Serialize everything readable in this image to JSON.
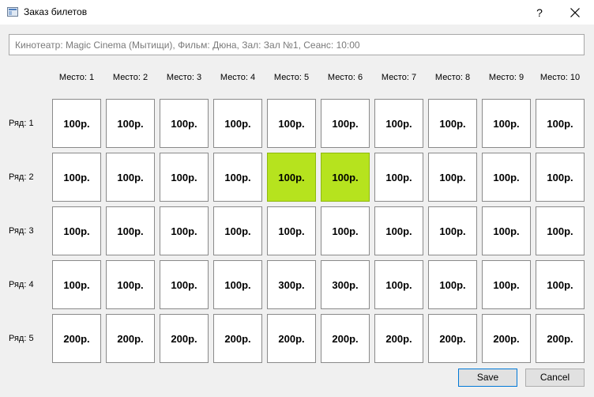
{
  "window": {
    "title": "Заказ билетов",
    "help_label": "?"
  },
  "info": {
    "text": "Кинотеатр: Magic Cinema (Мытищи), Фильм: Дюна, Зал: Зал №1, Сеанс: 10:00"
  },
  "columns": [
    "Место: 1",
    "Место: 2",
    "Место: 3",
    "Место: 4",
    "Место: 5",
    "Место: 6",
    "Место: 7",
    "Место: 8",
    "Место: 9",
    "Место: 10"
  ],
  "rows": [
    {
      "label": "Ряд: 1",
      "seats": [
        "100р.",
        "100р.",
        "100р.",
        "100р.",
        "100р.",
        "100р.",
        "100р.",
        "100р.",
        "100р.",
        "100р."
      ]
    },
    {
      "label": "Ряд: 2",
      "seats": [
        "100р.",
        "100р.",
        "100р.",
        "100р.",
        "100р.",
        "100р.",
        "100р.",
        "100р.",
        "100р.",
        "100р."
      ]
    },
    {
      "label": "Ряд: 3",
      "seats": [
        "100р.",
        "100р.",
        "100р.",
        "100р.",
        "100р.",
        "100р.",
        "100р.",
        "100р.",
        "100р.",
        "100р."
      ]
    },
    {
      "label": "Ряд: 4",
      "seats": [
        "100р.",
        "100р.",
        "100р.",
        "100р.",
        "300р.",
        "300р.",
        "100р.",
        "100р.",
        "100р.",
        "100р."
      ]
    },
    {
      "label": "Ряд: 5",
      "seats": [
        "200р.",
        "200р.",
        "200р.",
        "200р.",
        "200р.",
        "200р.",
        "200р.",
        "200р.",
        "200р.",
        "200р."
      ]
    }
  ],
  "selected_seats": [
    {
      "row": 2,
      "seat": 5
    },
    {
      "row": 2,
      "seat": 6
    }
  ],
  "colors": {
    "selected_seat": "#b6e31e",
    "seat": "#ffffff"
  },
  "icons": {
    "app": "window-icon",
    "close": "close-icon"
  },
  "buttons": {
    "save": "Save",
    "cancel": "Cancel"
  }
}
